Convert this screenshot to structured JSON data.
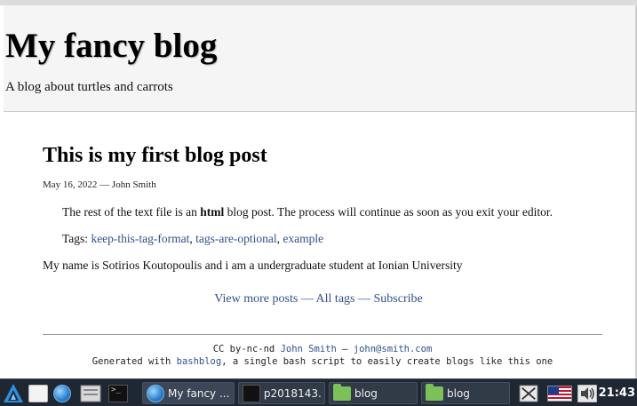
{
  "blog": {
    "title": "My fancy blog",
    "subtitle": "A blog about turtles and carrots"
  },
  "post": {
    "title": "This is my first blog post",
    "meta": "May 16, 2022 — John Smith",
    "body_before": "The rest of the text file is an ",
    "body_bold": "html",
    "body_after": " blog post. The process will continue as soon as you exit your editor.",
    "tags_label": "Tags: ",
    "tags": [
      "keep-this-tag-format",
      "tags-are-optional",
      "example"
    ],
    "tag_separator": ", "
  },
  "about": "My name is Sotirios Koutopoulis and i am a undergraduate student at Ionian University",
  "nav": {
    "more_posts": "View more posts",
    "all_tags": "All tags",
    "subscribe": "Subscribe",
    "separator": " — "
  },
  "footer": {
    "license": "CC by-nc-nd ",
    "author_link": "John Smith",
    "dash": " — ",
    "email_link": "john@smith.com",
    "generated_prefix": "Generated with ",
    "bashblog_link": "bashblog",
    "generated_suffix": ", a single bash script to easily create blogs like this one"
  },
  "taskbar": {
    "windows": [
      {
        "label": "My fancy ...",
        "icon": "globe-icon"
      },
      {
        "label": "p2018143...",
        "icon": "terminal-icon"
      },
      {
        "label": "blog",
        "icon": "folder-icon"
      },
      {
        "label": "blog",
        "icon": "folder-icon"
      }
    ],
    "clock": "21:43"
  },
  "colors": {
    "link": "#30508b",
    "header_bg": "#f5f5f5",
    "taskbar_bg": "#1f2732",
    "folder": "#7cc05a"
  }
}
